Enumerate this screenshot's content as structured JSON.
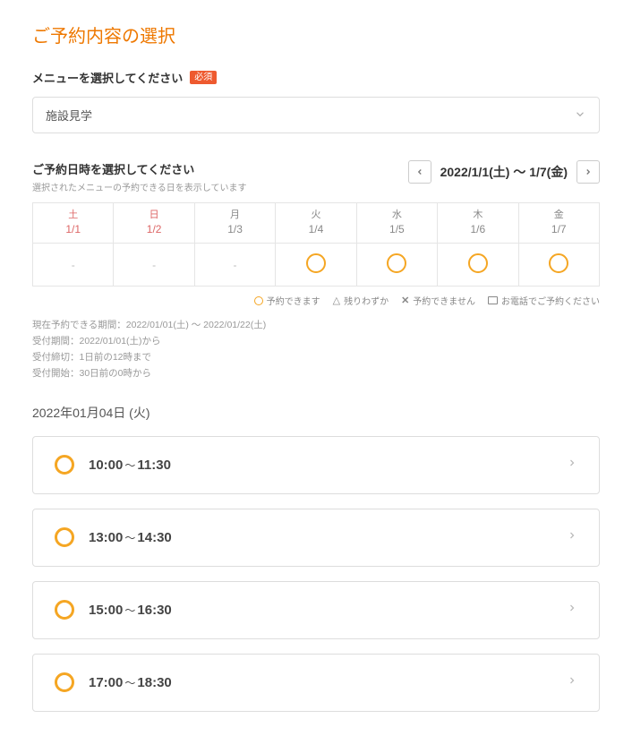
{
  "page_title": "ご予約内容の選択",
  "menu": {
    "label": "メニューを選択してください",
    "required_badge": "必須",
    "selected": "施設見学"
  },
  "date_section": {
    "label": "ご予約日時を選択してください",
    "sublabel": "選択されたメニューの予約できる日を表示しています",
    "range": "2022/1/1(土) 〜 1/7(金)"
  },
  "calendar": {
    "days": [
      {
        "dow": "土",
        "date": "1/1",
        "weekend": true,
        "status": "closed"
      },
      {
        "dow": "日",
        "date": "1/2",
        "weekend": true,
        "status": "closed"
      },
      {
        "dow": "月",
        "date": "1/3",
        "weekend": false,
        "status": "closed"
      },
      {
        "dow": "火",
        "date": "1/4",
        "weekend": false,
        "status": "open"
      },
      {
        "dow": "水",
        "date": "1/5",
        "weekend": false,
        "status": "open"
      },
      {
        "dow": "木",
        "date": "1/6",
        "weekend": false,
        "status": "open"
      },
      {
        "dow": "金",
        "date": "1/7",
        "weekend": false,
        "status": "open"
      }
    ]
  },
  "legend": {
    "open": "予約できます",
    "few": "残りわずか",
    "closed": "予約できません",
    "tel": "お電話でご予約ください"
  },
  "info_lines": [
    "現在予約できる期間：2022/01/01(土) 〜 2022/01/22(土)",
    "受付期間：2022/01/01(土)から",
    "受付締切：1日前の12時まで",
    "受付開始：30日前の0時から"
  ],
  "selected_date_label": "2022年01月04日 (火)",
  "time_slots": [
    {
      "start": "10:00",
      "end": "11:30"
    },
    {
      "start": "13:00",
      "end": "14:30"
    },
    {
      "start": "15:00",
      "end": "16:30"
    },
    {
      "start": "17:00",
      "end": "18:30"
    }
  ],
  "closed_marker": "-"
}
